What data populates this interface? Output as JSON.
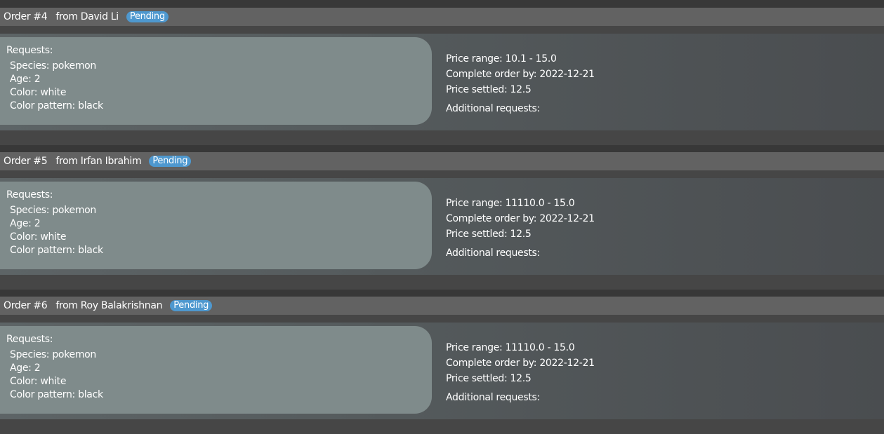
{
  "orders": [
    {
      "order_label": "Order",
      "number": "#4",
      "from_label": "from",
      "customer": "David Li",
      "status": "Pending",
      "requests_title": "Requests:",
      "requests": [
        "Species: pokemon",
        "Age: 2",
        "Color: white",
        "Color pattern: black"
      ],
      "price_range": "Price range: 10.1 - 15.0",
      "complete_by": "Complete order by: 2022-12-21",
      "price_settled": "Price settled: 12.5",
      "additional_requests": "Additional requests:"
    },
    {
      "order_label": "Order",
      "number": "#5",
      "from_label": "from",
      "customer": "Irfan Ibrahim",
      "status": "Pending",
      "requests_title": "Requests:",
      "requests": [
        "Species: pokemon",
        "Age: 2",
        "Color: white",
        "Color pattern: black"
      ],
      "price_range": "Price range: 11110.0 - 15.0",
      "complete_by": "Complete order by: 2022-12-21",
      "price_settled": "Price settled: 12.5",
      "additional_requests": "Additional requests:"
    },
    {
      "order_label": "Order",
      "number": "#6",
      "from_label": "from",
      "customer": "Roy Balakrishnan",
      "status": "Pending",
      "requests_title": "Requests:",
      "requests": [
        "Species: pokemon",
        "Age: 2",
        "Color: white",
        "Color pattern: black"
      ],
      "price_range": "Price range: 11110.0 - 15.0",
      "complete_by": "Complete order by: 2022-12-21",
      "price_settled": "Price settled: 12.5",
      "additional_requests": "Additional requests:"
    }
  ],
  "colors": {
    "background": "#383838",
    "header": "#626262",
    "badge": "#4e98cf",
    "requests_panel": "#7f8b8b",
    "text": "#ffffff"
  }
}
